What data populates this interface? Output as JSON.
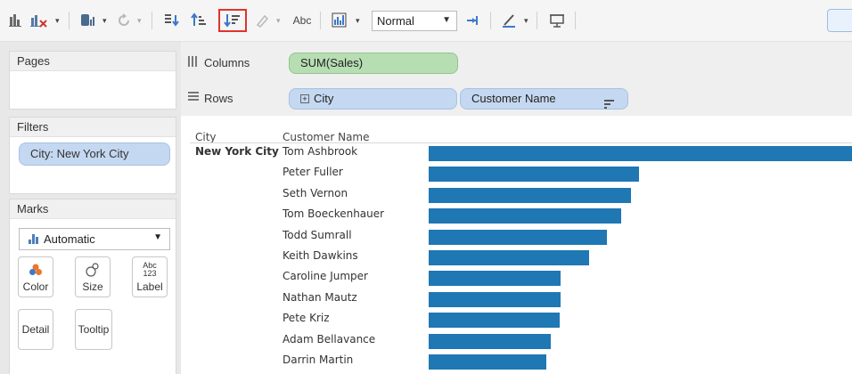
{
  "toolbar": {
    "mark_size_value": "Normal",
    "abc_label": "Abc",
    "icons": [
      "show-me-icon",
      "clear-sheet-icon",
      "data-source-icon",
      "refresh-icon",
      "swap-icon",
      "sort-ascending-icon",
      "sort-descending-icon",
      "highlight-icon",
      "labels-icon",
      "fit-icon",
      "fix-axes-icon",
      "annotate-icon",
      "presentation-icon"
    ]
  },
  "left_panel": {
    "pages_title": "Pages",
    "filters_title": "Filters",
    "filter_pill": "City: New York City",
    "marks_title": "Marks",
    "mark_type": "Automatic",
    "mark_buttons": {
      "color": "Color",
      "size": "Size",
      "label": "Label",
      "detail": "Detail",
      "tooltip": "Tooltip",
      "label_icon_top": "Abc",
      "label_icon_bottom": "123"
    }
  },
  "shelves": {
    "columns_label": "Columns",
    "columns_pill": "SUM(Sales)",
    "rows_label": "Rows",
    "rows_pills": [
      "City",
      "Customer Name"
    ]
  },
  "view": {
    "col_header_city": "City",
    "col_header_customer": "Customer Name",
    "city_value": "New York City"
  },
  "chart_data": {
    "type": "bar",
    "orientation": "horizontal",
    "categories": [
      "Tom Ashbrook",
      "Peter Fuller",
      "Seth Vernon",
      "Tom Boeckenhauer",
      "Todd Sumrall",
      "Keith Dawkins",
      "Caroline Jumper",
      "Nathan Mautz",
      "Pete Kriz",
      "Adam Bellavance",
      "Darrin Martin"
    ],
    "values": [
      14595,
      7180,
      6894,
      6573,
      6081,
      5468,
      4504,
      4504,
      4482,
      4180,
      4026
    ],
    "colors": {
      "bar": "#1f77b4"
    }
  }
}
